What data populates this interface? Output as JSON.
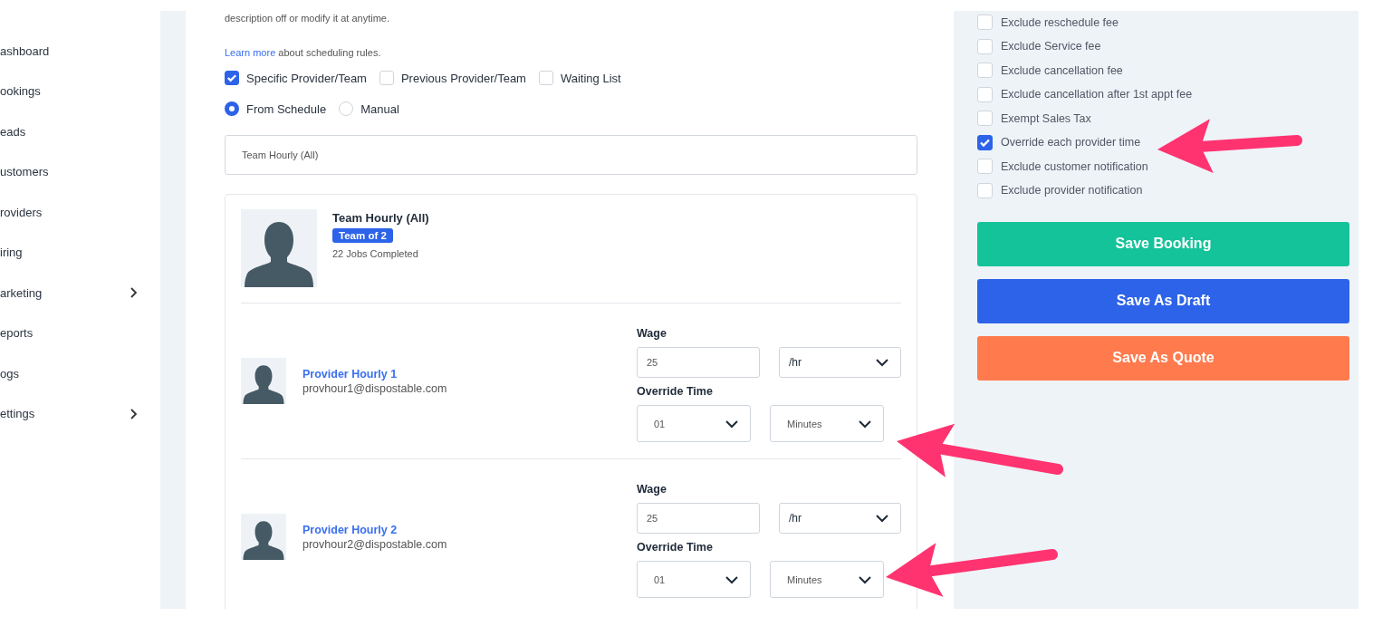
{
  "sidebar": {
    "items": [
      {
        "label": "ashboard",
        "expandable": false
      },
      {
        "label": "ookings",
        "expandable": false
      },
      {
        "label": "eads",
        "expandable": false
      },
      {
        "label": "ustomers",
        "expandable": false
      },
      {
        "label": "roviders",
        "expandable": false
      },
      {
        "label": "iring",
        "expandable": false
      },
      {
        "label": "arketing",
        "expandable": true
      },
      {
        "label": "eports",
        "expandable": false
      },
      {
        "label": "ogs",
        "expandable": false
      },
      {
        "label": "ettings",
        "expandable": true
      }
    ]
  },
  "main": {
    "intro": "description off or modify it at anytime.",
    "learn_more": {
      "link": "Learn more",
      "text": "about scheduling rules."
    },
    "assignment_options": [
      {
        "label": "Specific Provider/Team",
        "checked": true
      },
      {
        "label": "Previous Provider/Team",
        "checked": false
      },
      {
        "label": "Waiting List",
        "checked": false
      }
    ],
    "time_source": [
      {
        "label": "From Schedule",
        "selected": true
      },
      {
        "label": "Manual",
        "selected": false
      }
    ],
    "provider_select": {
      "value": "Team Hourly (All)"
    },
    "team": {
      "name": "Team Hourly (All)",
      "badge": "Team of 2",
      "jobs": "22 Jobs Completed"
    },
    "providers": [
      {
        "name": "Provider Hourly 1",
        "email": "provhour1@dispostable.com",
        "wage_label": "Wage",
        "wage": "25",
        "wage_unit": "/hr",
        "override_label": "Override Time",
        "time": "01",
        "time_unit": "Minutes"
      },
      {
        "name": "Provider Hourly 2",
        "email": "provhour2@dispostable.com",
        "wage_label": "Wage",
        "wage": "25",
        "wage_unit": "/hr",
        "override_label": "Override Time",
        "time": "01",
        "time_unit": "Minutes"
      }
    ]
  },
  "options": [
    {
      "label": "Exclude reschedule fee",
      "checked": false
    },
    {
      "label": "Exclude Service fee",
      "checked": false
    },
    {
      "label": "Exclude cancellation fee",
      "checked": false
    },
    {
      "label": "Exclude cancellation after 1st appt fee",
      "checked": false
    },
    {
      "label": "Exempt Sales Tax",
      "checked": false
    },
    {
      "label": "Override each provider time",
      "checked": true
    },
    {
      "label": "Exclude customer notification",
      "checked": false
    },
    {
      "label": "Exclude provider notification",
      "checked": false
    }
  ],
  "actions": [
    {
      "label": "Save Booking",
      "kind": "success"
    },
    {
      "label": "Save As Draft",
      "kind": "primary"
    },
    {
      "label": "Save As Quote",
      "kind": "warning"
    }
  ]
}
